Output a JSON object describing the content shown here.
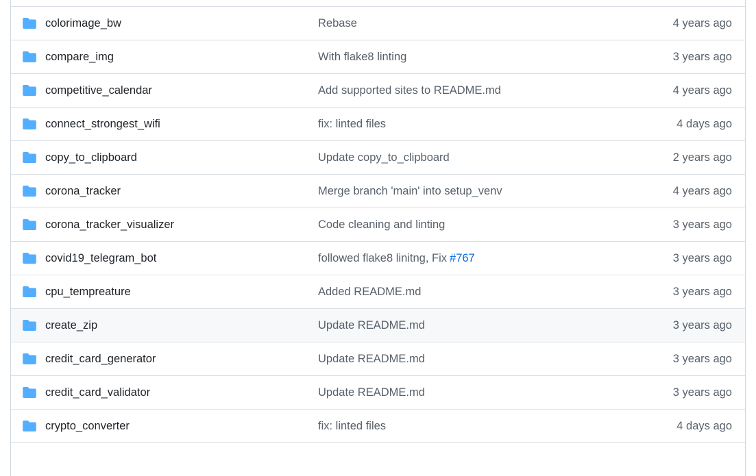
{
  "colors": {
    "folder": "#54aeff",
    "text": "#1f2328",
    "muted": "#57606a",
    "link": "#0969da",
    "border": "#d8dee4",
    "hover_bg": "#f6f8fa"
  },
  "rows": [
    {
      "name": "",
      "commit": "",
      "age": "",
      "icon": ""
    },
    {
      "name": "colorimage_bw",
      "commit": "Rebase",
      "age": "4 years ago",
      "icon": "folder-icon"
    },
    {
      "name": "compare_img",
      "commit": "With flake8 linting",
      "age": "3 years ago",
      "icon": "folder-icon"
    },
    {
      "name": "competitive_calendar",
      "commit": "Add supported sites to README.md",
      "age": "4 years ago",
      "icon": "folder-icon"
    },
    {
      "name": "connect_strongest_wifi",
      "commit": "fix: linted files",
      "age": "4 days ago",
      "icon": "folder-icon"
    },
    {
      "name": "copy_to_clipboard",
      "commit": "Update copy_to_clipboard",
      "age": "2 years ago",
      "icon": "folder-icon"
    },
    {
      "name": "corona_tracker",
      "commit": "Merge branch 'main' into setup_venv",
      "age": "4 years ago",
      "icon": "folder-icon"
    },
    {
      "name": "corona_tracker_visualizer",
      "commit": "Code cleaning and linting",
      "age": "3 years ago",
      "icon": "folder-icon"
    },
    {
      "name": "covid19_telegram_bot",
      "commit": "followed flake8 linitng, Fix",
      "issue": "#767",
      "age": "3 years ago",
      "icon": "folder-icon"
    },
    {
      "name": "cpu_tempreature",
      "commit": "Added README.md",
      "age": "3 years ago",
      "icon": "folder-icon"
    },
    {
      "name": "create_zip",
      "commit": "Update README.md",
      "age": "3 years ago",
      "icon": "folder-icon",
      "hover": true
    },
    {
      "name": "credit_card_generator",
      "commit": "Update README.md",
      "age": "3 years ago",
      "icon": "folder-icon"
    },
    {
      "name": "credit_card_validator",
      "commit": "Update README.md",
      "age": "3 years ago",
      "icon": "folder-icon"
    },
    {
      "name": "crypto_converter",
      "commit": "fix: linted files",
      "age": "4 days ago",
      "icon": "folder-icon"
    },
    {
      "name": "",
      "commit": "",
      "age": "",
      "icon": ""
    }
  ]
}
